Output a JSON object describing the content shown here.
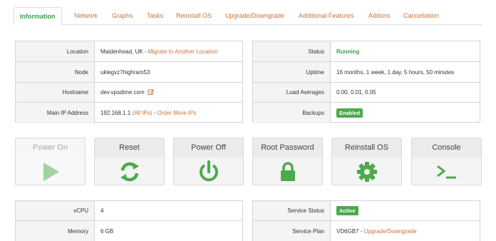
{
  "tabs": [
    {
      "label": "Information",
      "active": true
    },
    {
      "label": "Network"
    },
    {
      "label": "Graphs"
    },
    {
      "label": "Tasks"
    },
    {
      "label": "Reinstall OS"
    },
    {
      "label": "Upgrade/Downgrade"
    },
    {
      "label": "Additional Features"
    },
    {
      "label": "Addons"
    },
    {
      "label": "Cancellation"
    }
  ],
  "server": {
    "location_label": "Location",
    "location_value": "Maidenhead, UK -",
    "location_link": "Migrate to Another Location",
    "node_label": "Node",
    "node_value": "uklegvz7highram53",
    "hostname_label": "Hostname",
    "hostname_value": "dev.vpsdime.com",
    "ip_label": "Main IP Address",
    "ip_value": "192.168.1.1",
    "ip_all_link": "(All IPs)",
    "ip_sep": "-",
    "ip_order_link": "Order More IPs"
  },
  "status": {
    "status_label": "Status",
    "status_value": "Running",
    "uptime_label": "Uptime",
    "uptime_value": "16 months, 1 week, 1 day, 5 hours, 50 minutes",
    "load_label": "Load Averages",
    "load_value": "0.00, 0.01, 0.05",
    "backups_label": "Backups",
    "backups_value": "Enabled"
  },
  "actions": [
    {
      "label": "Power On",
      "icon": "play-icon",
      "disabled": true
    },
    {
      "label": "Reset",
      "icon": "refresh-icon"
    },
    {
      "label": "Power Off",
      "icon": "power-icon"
    },
    {
      "label": "Root Password",
      "icon": "lock-icon"
    },
    {
      "label": "Reinstall OS",
      "icon": "gear-icon"
    },
    {
      "label": "Console",
      "icon": "terminal-icon"
    }
  ],
  "resources": {
    "vcpu_label": "vCPU",
    "vcpu_value": "4",
    "memory_label": "Memory",
    "memory_value": "6 GB"
  },
  "service": {
    "status_label": "Service Status",
    "status_value": "Active",
    "plan_label": "Service Plan",
    "plan_value": "VD6GB7 -",
    "plan_link": "Upgrade/Downgrade"
  },
  "colors": {
    "accent_link": "#c8733a",
    "success": "#3d9c4c",
    "icon_green": "#4caa4c",
    "disabled_icon": "#9fd39f"
  }
}
